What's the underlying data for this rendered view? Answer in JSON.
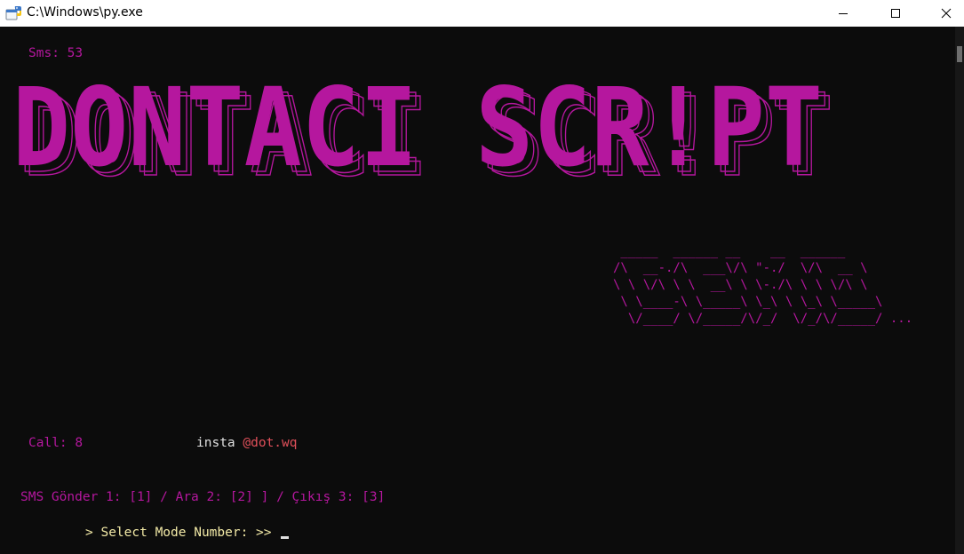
{
  "window": {
    "title": "C:\\Windows\\py.exe",
    "controls": [
      "minimize",
      "maximize",
      "close"
    ]
  },
  "console": {
    "sms_counter": "Sms: 53",
    "banner_text": "DONTACI SCR!PT",
    "ascii_art": " _____  ______ __    __  ______\n/\\  __-./\\  ___\\/\\ \"-./  \\/\\  __ \\\n\\ \\ \\/\\ \\ \\  __\\ \\ \\-./\\ \\ \\ \\/\\ \\\n \\ \\____-\\ \\_____\\ \\_\\ \\ \\_\\ \\_____\\\n  \\/____/ \\/_____/\\/_/  \\/_/\\/_____/ ...",
    "call_counter": "Call: 8",
    "insta_label": "insta",
    "insta_handle": "@dot.wq",
    "menu": "SMS Gönder 1: [1] / Ara 2: [2] ] / Çıkış 3: [3]",
    "prompt": "> Select Mode Number: >>"
  },
  "colors": {
    "background": "#0c0c0c",
    "accent_magenta": "#b5179e",
    "text_white": "#e0e0e0",
    "handle_red": "#e0505a",
    "prompt_yellow": "#f2e9a6"
  },
  "icons": {
    "app": "python-icon",
    "minimize": "minimize-icon",
    "maximize": "maximize-icon",
    "close": "close-icon"
  }
}
